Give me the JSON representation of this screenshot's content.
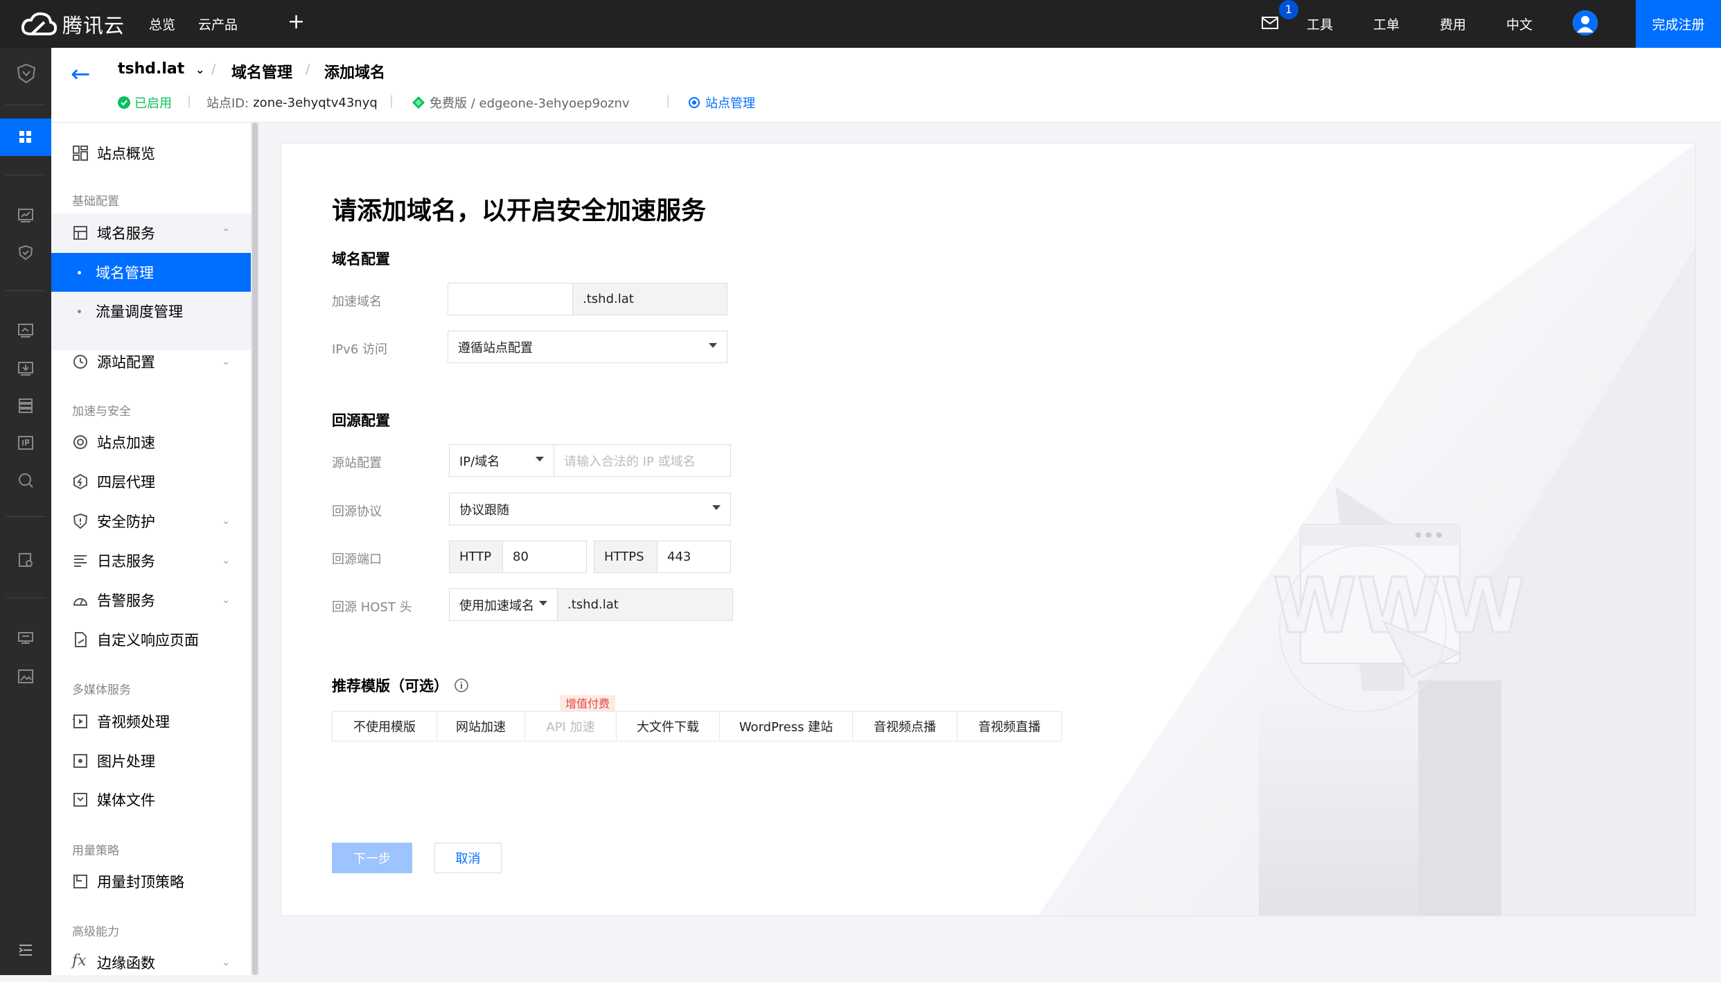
{
  "topbar": {
    "brand": "腾讯云",
    "nav": [
      "总览",
      "云产品"
    ],
    "plus": "+",
    "mail_badge": "1",
    "right_nav": [
      "工具",
      "工单",
      "费用",
      "中文"
    ],
    "cta": "完成注册"
  },
  "header": {
    "site": "tshd.lat",
    "crumbs": [
      "域名管理",
      "添加域名"
    ],
    "status": "已启用",
    "site_id_label": "站点ID:",
    "site_id": "zone-3ehyqtv43nyq",
    "plan": "免费版 / edgeone-3ehyoep9oznv",
    "site_manage": "站点管理"
  },
  "sidebar": {
    "overview": "站点概览",
    "groups": {
      "basic": "基础配置",
      "accel": "加速与安全",
      "media": "多媒体服务",
      "usage": "用量策略",
      "advanced": "高级能力"
    },
    "domain_service": "域名服务",
    "domain_manage": "域名管理",
    "traffic": "流量调度管理",
    "origin": "源站配置",
    "site_accel": "站点加速",
    "l4proxy": "四层代理",
    "security": "安全防护",
    "logs": "日志服务",
    "alarm": "告警服务",
    "custom_page": "自定义响应页面",
    "av": "音视频处理",
    "image": "图片处理",
    "media_file": "媒体文件",
    "usage_cap": "用量封顶策略",
    "edge_fn": "边缘函数"
  },
  "form": {
    "title": "请添加域名，以开启安全加速服务",
    "section_domain": "域名配置",
    "accel_domain_label": "加速域名",
    "domain_suffix": ".tshd.lat",
    "ipv6_label": "IPv6 访问",
    "ipv6_value": "遵循站点配置",
    "section_origin": "回源配置",
    "origin_label": "源站配置",
    "origin_type": "IP/域名",
    "origin_placeholder": "请输入合法的 IP 或域名",
    "protocol_label": "回源协议",
    "protocol_value": "协议跟随",
    "port_label": "回源端口",
    "http": "HTTP",
    "http_port": "80",
    "https": "HTTPS",
    "https_port": "443",
    "host_label": "回源 HOST 头",
    "host_type": "使用加速域名",
    "host_value": ".tshd.lat",
    "section_template": "推荐模版（可选）",
    "vat_badge": "增值付费",
    "templates": [
      "不使用模版",
      "网站加速",
      "API 加速",
      "大文件下载",
      "WordPress 建站",
      "音视频点播",
      "音视频直播"
    ],
    "next": "下一步",
    "cancel": "取消"
  },
  "colors": {
    "primary": "#006eff",
    "topbar": "#222222",
    "rail": "#2b2b2b",
    "success": "#0abf5b",
    "disabled_primary": "#9ec4ff"
  }
}
